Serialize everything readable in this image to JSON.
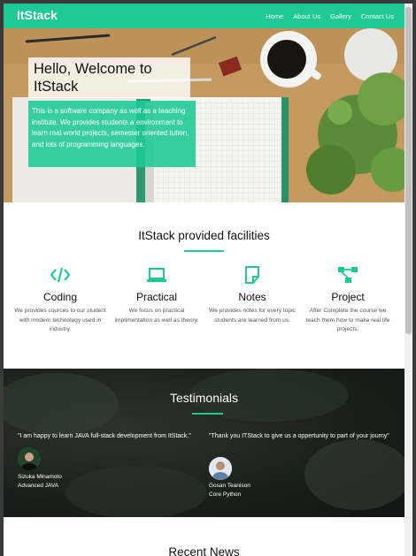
{
  "nav": {
    "brand": "ItStack",
    "links": [
      "Home",
      "About Us",
      "Gallery",
      "Contact Us"
    ]
  },
  "hero": {
    "title": "Hello, Welcome to ItStack",
    "description": "This is a software company as well as a teaching institute. We provides students a environment to learn real world projects, semester oriented tution, and lots of programming languages."
  },
  "facilities": {
    "title": "ItStack provided facilities",
    "items": [
      {
        "icon": "code-icon",
        "title": "Coding",
        "desc": "We provides cources to our student with modern technology used in industry."
      },
      {
        "icon": "laptop-icon",
        "title": "Practical",
        "desc": "We focus on practical implimentation as well as theory."
      },
      {
        "icon": "note-icon",
        "title": "Notes",
        "desc": "We provides notes for every topic students are learned from us."
      },
      {
        "icon": "project-diagram-icon",
        "title": "Project",
        "desc": "After Complete the course we teach them how to make real life projects."
      }
    ]
  },
  "testimonials": {
    "title": "Testimonials",
    "items": [
      {
        "quote": "\"I am happy to learn JAVA full-stack development from ItStack.\"",
        "name": "Sizuka Minamoto",
        "course": "Advanced JAVA"
      },
      {
        "quote": "\"Thank you ITStack to give us a oppertunity to part of your journy\"",
        "name": "Gosan Teanison",
        "course": "Core Python"
      }
    ]
  },
  "recent_news": {
    "title": "Recent News"
  },
  "colors": {
    "accent": "#1ec995",
    "dark_section": "#1a1f1b"
  }
}
